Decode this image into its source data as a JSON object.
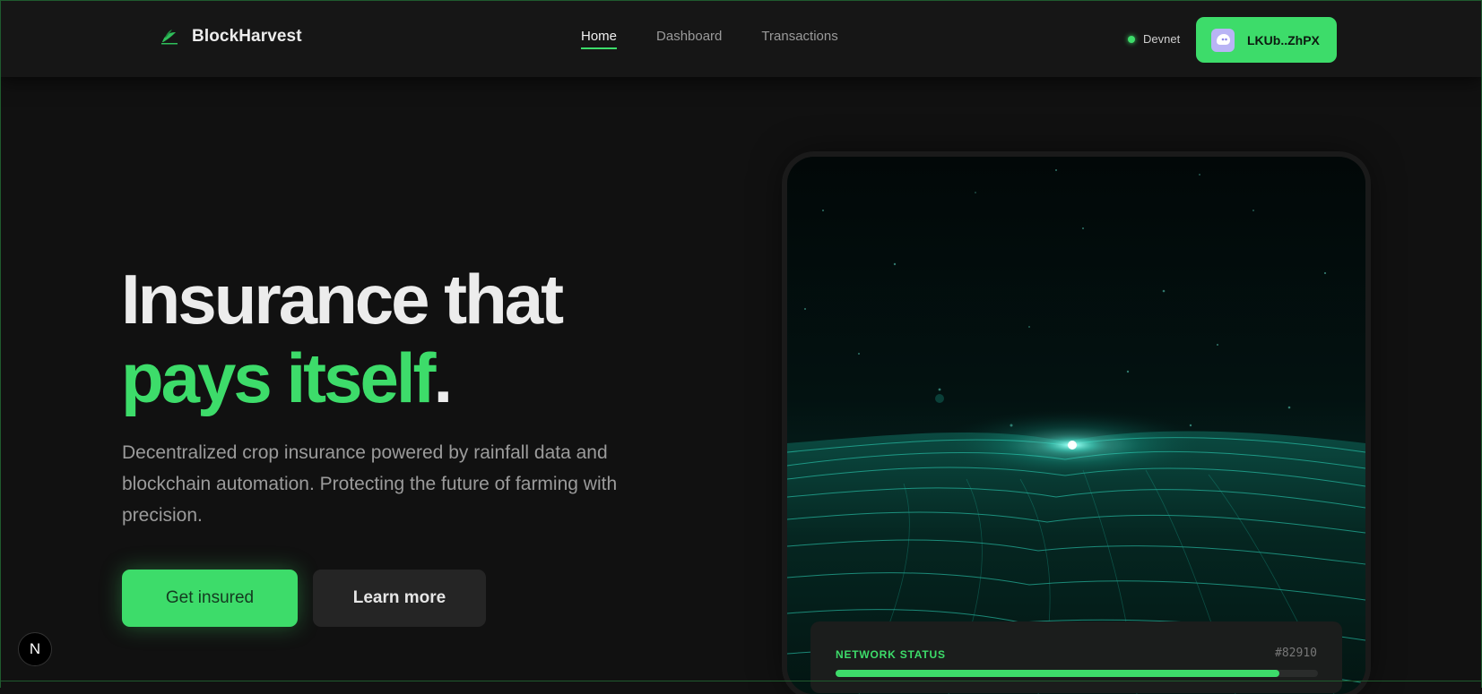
{
  "brand": {
    "name": "BlockHarvest",
    "icon": "leaf-logo-icon"
  },
  "nav": {
    "links": [
      {
        "label": "Home",
        "active": true
      },
      {
        "label": "Dashboard",
        "active": false
      },
      {
        "label": "Transactions",
        "active": false
      }
    ]
  },
  "network": {
    "label": "Devnet",
    "status_color": "#3ddc6a"
  },
  "wallet": {
    "address": "LKUb..ZhPX",
    "icon": "phantom-ghost-icon"
  },
  "hero": {
    "headline_line1": "Insurance that",
    "headline_line2": "pays itself",
    "headline_period": ".",
    "subtitle": "Decentralized crop insurance powered by rainfall data and blockchain automation. Protecting the future of farming with precision.",
    "primary_button": "Get insured",
    "secondary_button": "Learn more"
  },
  "status_card": {
    "label": "NETWORK STATUS",
    "id": "#82910",
    "progress": 0.92
  },
  "dev_badge": {
    "letter": "N"
  },
  "colors": {
    "accent": "#3ddc6a",
    "background": "#111111",
    "navbar": "#161616"
  }
}
